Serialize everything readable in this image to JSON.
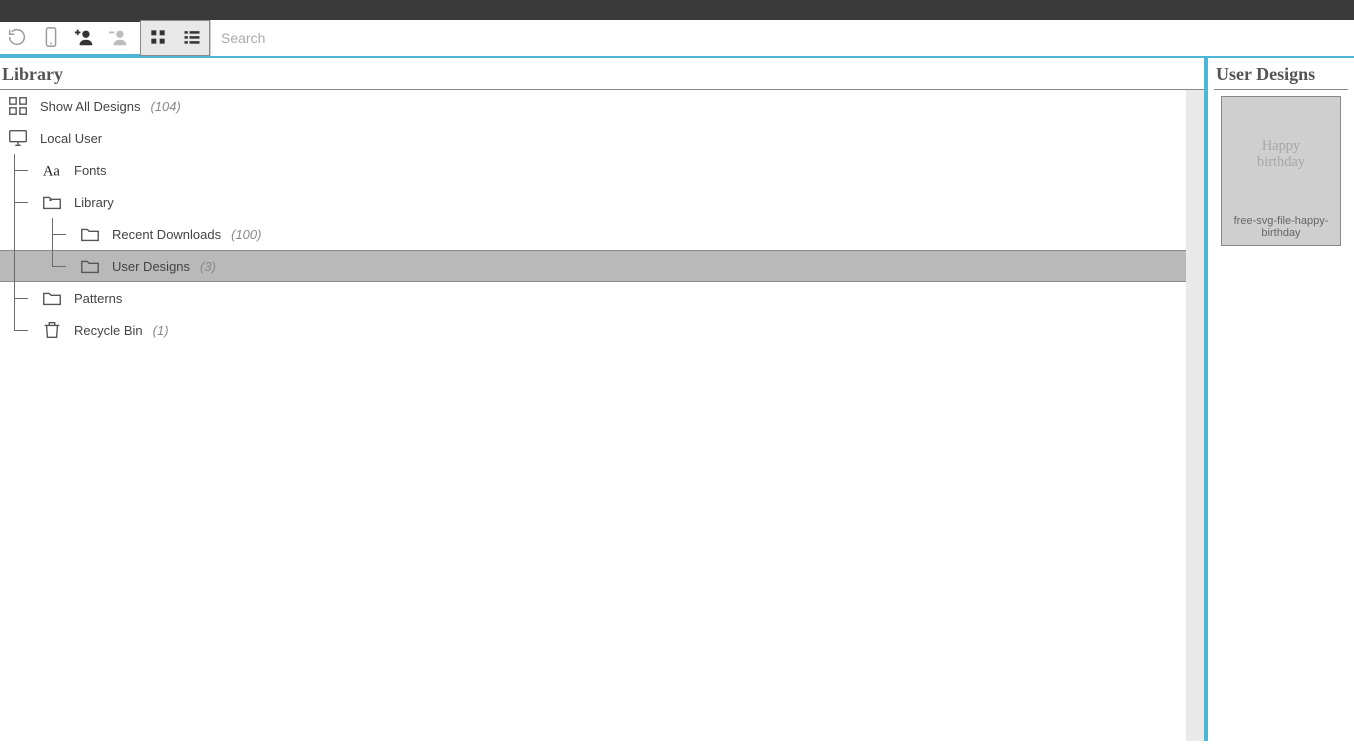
{
  "toolbar": {
    "search_placeholder": "Search"
  },
  "library": {
    "title": "Library",
    "show_all_label": "Show All Designs",
    "show_all_count": "(104)",
    "local_user_label": "Local User",
    "fonts_label": "Fonts",
    "library_label": "Library",
    "recent_downloads_label": "Recent Downloads",
    "recent_downloads_count": "(100)",
    "user_designs_label": "User Designs",
    "user_designs_count": "(3)",
    "patterns_label": "Patterns",
    "recycle_bin_label": "Recycle Bin",
    "recycle_bin_count": "(1)"
  },
  "designs_panel": {
    "title": "User Designs",
    "items": [
      {
        "caption": "free-svg-file-happy-birthday"
      }
    ]
  }
}
